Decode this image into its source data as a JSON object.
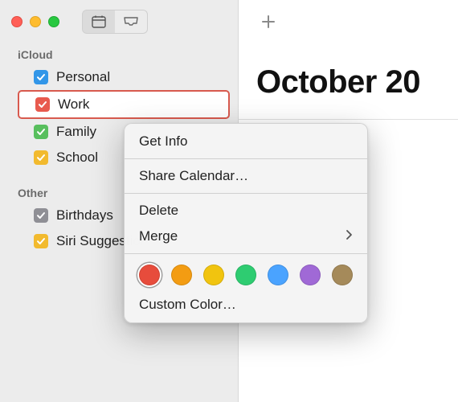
{
  "title": "October 20",
  "sidebar": {
    "sections": [
      {
        "name": "iCloud",
        "items": [
          {
            "label": "Personal",
            "color": "#3296e8",
            "checked": true,
            "selected": false
          },
          {
            "label": "Work",
            "color": "#e85a4e",
            "checked": true,
            "selected": true
          },
          {
            "label": "Family",
            "color": "#58bf5d",
            "checked": true,
            "selected": false
          },
          {
            "label": "School",
            "color": "#f2ba2e",
            "checked": true,
            "selected": false
          }
        ]
      },
      {
        "name": "Other",
        "items": [
          {
            "label": "Birthdays",
            "color": "#8f8f95",
            "checked": true,
            "selected": false
          },
          {
            "label": "Siri Suggestions",
            "color": "#f2ba2e",
            "checked": true,
            "selected": false
          }
        ]
      }
    ]
  },
  "context_menu": {
    "items": {
      "get_info": "Get Info",
      "share": "Share Calendar…",
      "delete": "Delete",
      "merge": "Merge",
      "custom_color": "Custom Color…"
    },
    "colors": [
      {
        "hex": "#e74c3c",
        "selected": true
      },
      {
        "hex": "#f39c12",
        "selected": false
      },
      {
        "hex": "#f1c40f",
        "selected": false
      },
      {
        "hex": "#2ecc71",
        "selected": false
      },
      {
        "hex": "#4aa3ff",
        "selected": false
      },
      {
        "hex": "#a069d6",
        "selected": false
      },
      {
        "hex": "#a58a5a",
        "selected": false
      }
    ]
  }
}
